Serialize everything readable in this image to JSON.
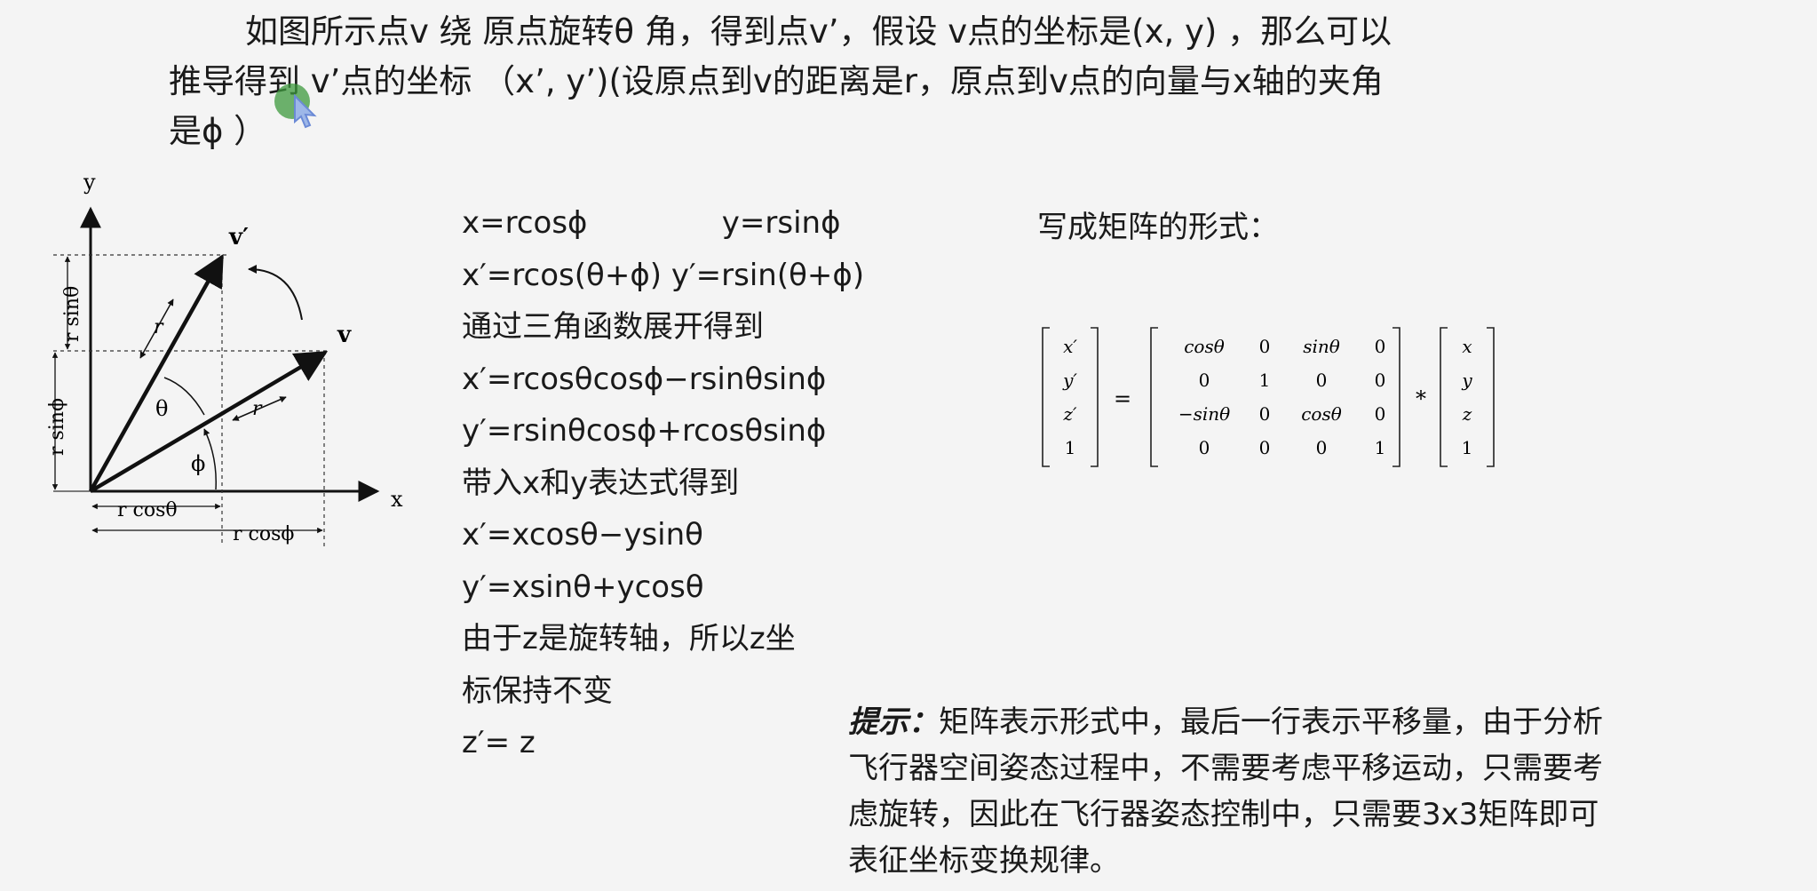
{
  "intro": {
    "line1": "如图所示点v 绕 原点旋转θ 角，得到点v’，假设 v点的坐标是(x, y) ，那么可以",
    "line2": "推导得到 v’点的坐标 （x’, y’)(设原点到v的距离是r，原点到v点的向量与x轴的夹角",
    "line3": "是ϕ ）"
  },
  "diagram": {
    "y_axis": "y",
    "x_axis": "x",
    "v_prime": "v′",
    "v": "v",
    "r_upper": "r",
    "r_lower": "r",
    "theta": "θ",
    "phi": "ϕ",
    "r_sin_theta": "r sinθ",
    "r_sin_phi": "r sinϕ",
    "r_cos_theta": "r cosθ",
    "r_cos_phi": "r cosϕ"
  },
  "equations": [
    "x=rcosϕ              y=rsinϕ",
    "x′=rcos(θ+ϕ) y′=rsin(θ+ϕ)",
    "通过三角函数展开得到",
    "x′=rcosθcosϕ−rsinθsinϕ",
    "y′=rsinθcosϕ+rcosθsinϕ",
    "带入x和y表达式得到",
    "x′=xcosθ−ysinθ",
    "y′=xsinθ+ycosθ",
    "由于z是旋转轴，所以z坐",
    "标保持不变",
    "z′= z"
  ],
  "matrix_section": {
    "title": "写成矩阵的形式：",
    "lhs": [
      "x′",
      "y′",
      "z′",
      "1"
    ],
    "equals": "=",
    "rotation": [
      [
        "cosθ",
        "0",
        "sinθ",
        "0"
      ],
      [
        "0",
        "1",
        "0",
        "0"
      ],
      [
        "−sinθ",
        "0",
        "cosθ",
        "0"
      ],
      [
        "0",
        "0",
        "0",
        "1"
      ]
    ],
    "times": "*",
    "rhs": [
      "x",
      "y",
      "z",
      "1"
    ]
  },
  "tip": {
    "label": "提示：",
    "line1": "矩阵表示形式中，最后一行表示平移量，由于分析",
    "line2": "飞行器空间姿态过程中，不需要考虑平移运动，只需要考",
    "line3": "虑旋转，因此在飞行器姿态控制中，只需要3x3矩阵即可",
    "line4": "表征坐标变换规律。"
  }
}
